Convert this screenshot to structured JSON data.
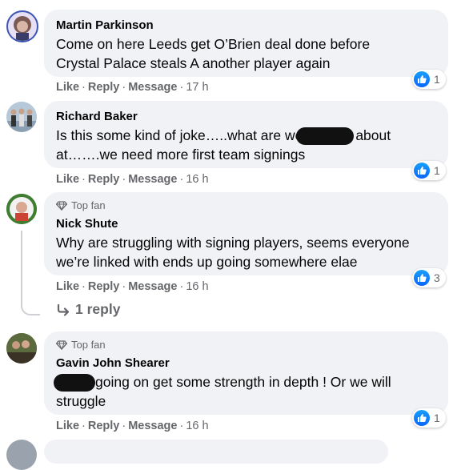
{
  "actions": {
    "like": "Like",
    "reply": "Reply",
    "message": "Message"
  },
  "comments": [
    {
      "name": "Martin Parkinson",
      "text_line1": "Come on here Leeds get O’Brien deal done before",
      "text_line2": "Crystal Palace steals A another player again",
      "time": "17 h",
      "reactions": "1"
    },
    {
      "name": "Richard Baker",
      "text_part1": "Is this some kind of joke…..what are we",
      "text_part2": "about",
      "text_line2": "at…….we need more first team signings",
      "time": "16 h",
      "reactions": "1"
    },
    {
      "badge": "Top fan",
      "name": "Nick Shute",
      "text_line1": "Why are struggling with signing players, seems everyone",
      "text_line2": "we’re linked with ends up going somewhere elae",
      "time": "16 h",
      "reactions": "3",
      "reply_link": "1 reply"
    },
    {
      "badge": "Top fan",
      "name": "Gavin John Shearer",
      "text_part1": "going on get some strength in depth ! Or we will",
      "text_line2": "struggle",
      "time": "16 h",
      "reactions": "1"
    }
  ],
  "colors": {
    "bubble": "#f0f2f5",
    "meta": "#65676b",
    "like_blue": "#0866ff"
  }
}
